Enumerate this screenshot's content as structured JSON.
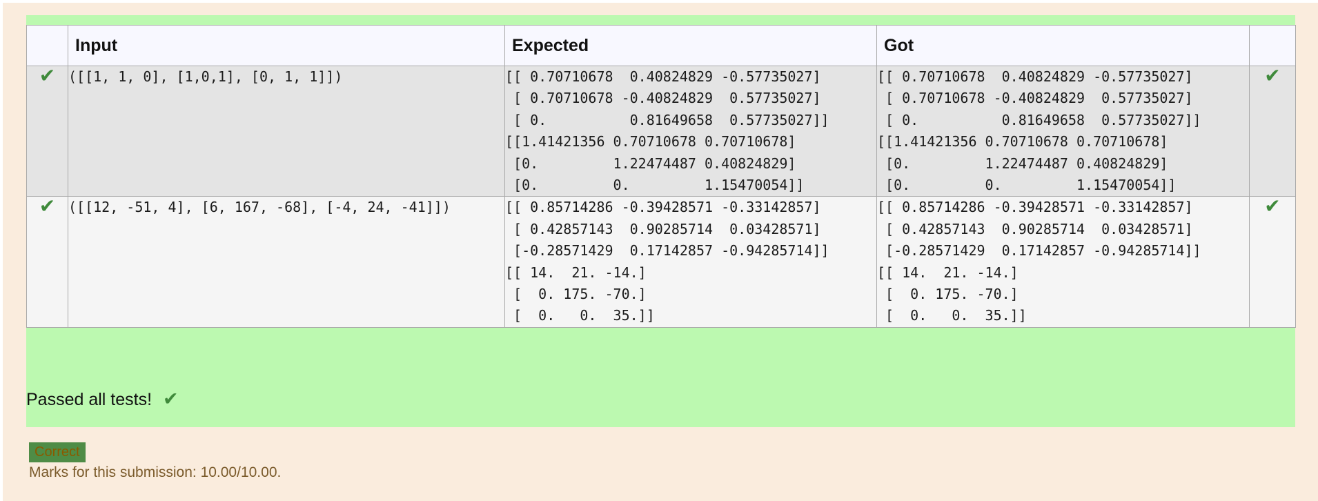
{
  "table": {
    "headers": [
      "Input",
      "Expected",
      "Got"
    ],
    "rows": [
      {
        "status_icon": "check-icon",
        "input": "([[1, 1, 0], [1,0,1], [0, 1, 1]])",
        "expected": "[[ 0.70710678  0.40824829 -0.57735027]\n [ 0.70710678 -0.40824829  0.57735027]\n [ 0.          0.81649658  0.57735027]]\n[[1.41421356 0.70710678 0.70710678]\n [0.         1.22474487 0.40824829]\n [0.         0.         1.15470054]]",
        "got": "[[ 0.70710678  0.40824829 -0.57735027]\n [ 0.70710678 -0.40824829  0.57735027]\n [ 0.          0.81649658  0.57735027]]\n[[1.41421356 0.70710678 0.70710678]\n [0.         1.22474487 0.40824829]\n [0.         0.         1.15470054]]",
        "result_icon": "check-icon"
      },
      {
        "status_icon": "check-icon",
        "input": "([[12, -51, 4], [6, 167, -68], [-4, 24, -41]])",
        "expected": "[[ 0.85714286 -0.39428571 -0.33142857]\n [ 0.42857143  0.90285714  0.03428571]\n [-0.28571429  0.17142857 -0.94285714]]\n[[ 14.  21. -14.]\n [  0. 175. -70.]\n [  0.   0.  35.]]",
        "got": "[[ 0.85714286 -0.39428571 -0.33142857]\n [ 0.42857143  0.90285714  0.03428571]\n [-0.28571429  0.17142857 -0.94285714]]\n[[ 14.  21. -14.]\n [  0. 175. -70.]\n [  0.   0.  35.]]",
        "result_icon": "check-icon"
      }
    ]
  },
  "summary": {
    "text": "Passed all tests!",
    "icon": "check-icon"
  },
  "grade": {
    "badge": "Correct",
    "marks_text": "Marks for this submission: 10.00/10.00."
  },
  "colors": {
    "page_bg": "#faecdd",
    "pass_bg": "#bcf9b0",
    "check": "#3f8a3b",
    "badge_bg": "#4f8c46"
  }
}
